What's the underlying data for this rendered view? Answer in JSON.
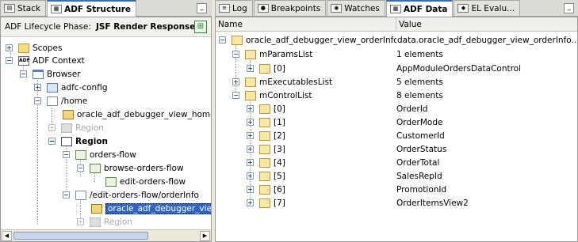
{
  "left_tabs": [
    {
      "label": "Stack",
      "icon": "stack-icon",
      "active": false
    },
    {
      "label": "ADF Structure",
      "icon": "adf-structure-icon",
      "active": true
    }
  ],
  "right_tabs": [
    {
      "label": "Log",
      "icon": "log-icon",
      "active": false
    },
    {
      "label": "Breakpoints",
      "icon": "breakpoints-icon",
      "active": false
    },
    {
      "label": "Watches",
      "icon": "watches-icon",
      "active": false
    },
    {
      "label": "ADF Data",
      "icon": "adf-data-icon",
      "active": true
    },
    {
      "label": "EL Evalu...",
      "icon": "el-evaluator-icon",
      "active": false
    }
  ],
  "phase": {
    "label": "ADF Lifecycle Phase:",
    "value": "JSF Render Response"
  },
  "tree": [
    {
      "label": "Scopes",
      "icon": "folder-icon"
    },
    {
      "label": "ADF Context",
      "icon": "adf-context-icon"
    },
    {
      "label": "Browser",
      "icon": "browser-window-icon"
    },
    {
      "label": "adfc-config",
      "icon": "taskflow-config-icon"
    },
    {
      "label": "/home",
      "icon": "page-icon"
    },
    {
      "label": "oracle_adf_debugger_view_home",
      "icon": "jsp-file-icon"
    },
    {
      "label": "Region",
      "icon": "region-icon"
    },
    {
      "label": "Region",
      "icon": "region-icon"
    },
    {
      "label": "orders-flow",
      "icon": "taskflow-icon"
    },
    {
      "label": "browse-orders-flow",
      "icon": "taskflow-icon"
    },
    {
      "label": "edit-orders-flow",
      "icon": "taskflow-icon"
    },
    {
      "label": "/edit-orders-flow/orderInfo",
      "icon": "page-icon"
    },
    {
      "label": "oracle_adf_debugger_view_orderInfo",
      "icon": "jsp-file-icon"
    },
    {
      "label": "Region",
      "icon": "region-icon"
    }
  ],
  "data_headers": {
    "name": "Name",
    "value": "Value"
  },
  "data_rows": [
    {
      "name": "oracle_adf_debugger_view_orderInfoPageDef",
      "value": "data.oracle_adf_debugger_view_orderInfo..."
    },
    {
      "name": "mParamsList",
      "value": "1 elements"
    },
    {
      "name": "[0]",
      "value": "AppModuleOrdersDataControl"
    },
    {
      "name": "mExecutablesList",
      "value": "5 elements"
    },
    {
      "name": "mControlList",
      "value": "8 elements"
    },
    {
      "name": "[0]",
      "value": "OrderId"
    },
    {
      "name": "[1]",
      "value": "OrderMode"
    },
    {
      "name": "[2]",
      "value": "CustomerId"
    },
    {
      "name": "[3]",
      "value": "OrderStatus"
    },
    {
      "name": "[4]",
      "value": "OrderTotal"
    },
    {
      "name": "[5]",
      "value": "SalesRepId"
    },
    {
      "name": "[6]",
      "value": "PromotionId"
    },
    {
      "name": "[7]",
      "value": "OrderItemsView2"
    }
  ],
  "colors": {
    "selection": "#2f64c9",
    "active_tab_border": "#3a6ea5"
  }
}
